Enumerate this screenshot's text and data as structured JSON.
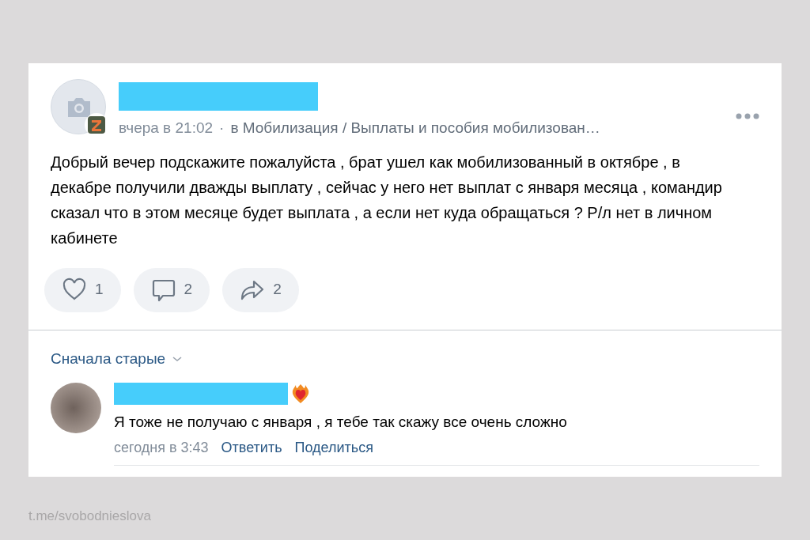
{
  "post": {
    "author_redacted": true,
    "time": "вчера в 21:02",
    "separator": "·",
    "community": "в Мобилизация / Выплаты и пособия мобилизован…",
    "text": "Добрый вечер подскажите пожалуйста , брат ушел как мобилизованный в октябре , в декабре получили дважды выплату , сейчас у него нет выплат с января месяца , командир сказал что в этом месяце будет выплата , а если нет куда обращаться ? Р/л нет в личном кабинете",
    "actions": [
      {
        "kind": "like",
        "count": "1"
      },
      {
        "kind": "comment",
        "count": "2"
      },
      {
        "kind": "share",
        "count": "2"
      }
    ]
  },
  "comments_sort": "Сначала старые",
  "comments": [
    {
      "author_redacted": true,
      "text": "Я тоже не получаю с января , я тебе так скажу все очень сложно",
      "time": "сегодня в 3:43",
      "actions": [
        "Ответить",
        "Поделиться"
      ]
    }
  ],
  "credit": "t.me/svobodnieslova"
}
